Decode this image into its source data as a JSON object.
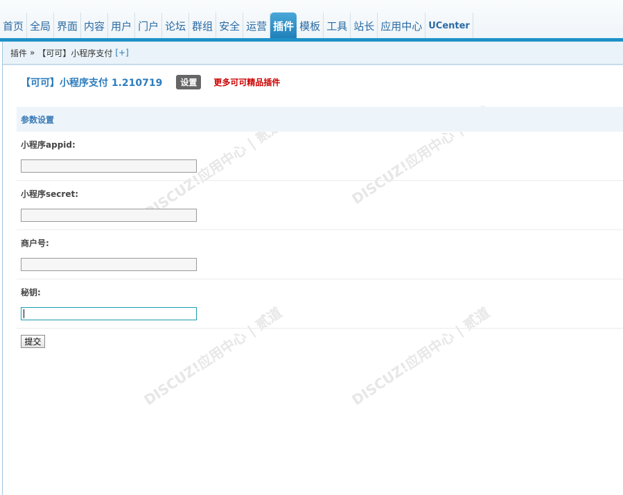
{
  "nav": [
    "首页",
    "全局",
    "界面",
    "内容",
    "用户",
    "门户",
    "论坛",
    "群组",
    "安全",
    "运营",
    "插件",
    "模板",
    "工具",
    "站长",
    "应用中心",
    "UCenter"
  ],
  "breadcrumb": {
    "item1": "插件",
    "sep": "»",
    "item2": "【可可】小程序支付",
    "add": "[+]"
  },
  "plugin": {
    "title": "【可可】小程序支付 1.210719",
    "settings_button": "设置",
    "more_link": "更多可可精品插件"
  },
  "section_title": "参数设置",
  "fields": [
    {
      "label": "小程序appid:",
      "value": ""
    },
    {
      "label": "小程序secret:",
      "value": ""
    },
    {
      "label": "商户号:",
      "value": ""
    },
    {
      "label": "秘钥:",
      "value": ""
    }
  ],
  "submit_label": "提交",
  "watermark": "DISCUZ!应用中心 | 贰道",
  "colors": {
    "accent": "#1e92c8",
    "more": "#cc0000"
  }
}
